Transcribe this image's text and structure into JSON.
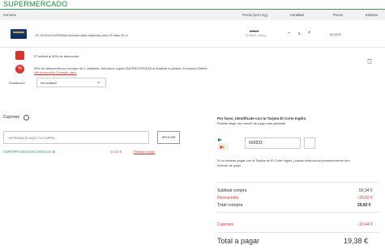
{
  "header": {
    "title": "SUPERMERCADO"
  },
  "table_head": {
    "cerveza": "Cerveza",
    "precio_ud": "Precio (Ud o Kg)",
    "cantidad": "Cantidad",
    "precio": "Precio",
    "eliminar": "Eliminar"
  },
  "product": {
    "name": "EL ÁGUILA DORADA cerveza rubia especial pack 10 latas 33 cl",
    "old_price": "8,39 €",
    "unit_price": "(2,54 € / Litro)",
    "qty": "6",
    "minus": "–",
    "plus": "+",
    "total": "50,34 €",
    "promo1": "2ª unidad al 50% de descuento",
    "promo1_badge": "50%",
    "promo2": "35% de descuento por compra de 2 unidades. Introduce cupón SUPERCERVEZA al finalizar tu pedido. Exclusivo Online.",
    "promo2_badge": "%",
    "promo2_link": "Ver promoción. Excepto ofert.",
    "substitution_label": "Sustitución",
    "substitution_value": "No sustituir"
  },
  "coupons": {
    "title": "Cupones",
    "placeholder": "INTRODUCE AQUÍ TU CUPÓN",
    "apply": "APLICAR",
    "applied_name": "SUPERPROMOCION CERVEZA 35",
    "applied_amount": "- 10,44 €",
    "remove": "Eliminar cupón"
  },
  "eci_card": {
    "title": "Por favor, identifícate con tu Tarjeta El Corte Inglés.",
    "subtitle": "Podrás elegir otro medio de pago más adelante",
    "card_value": "600833",
    "note": "Si no deseas pagar con la Tarjeta de El Corte Inglés, podrás seleccionar posteriormente otro método de pago."
  },
  "summary": {
    "subtotal_label": "Subtotal compra",
    "subtotal": "50,34 €",
    "discount_label": "Descuentos",
    "discount": "- 20,52 €",
    "total_label": "Total compra",
    "total": "29,82 €",
    "coupons_label": "Cupones",
    "coupons": "- 10,44 €",
    "pay_label": "Total a pagar",
    "pay": "19,38 €"
  },
  "colors": {
    "green": "#1a8a3a",
    "red": "#d9342b"
  }
}
